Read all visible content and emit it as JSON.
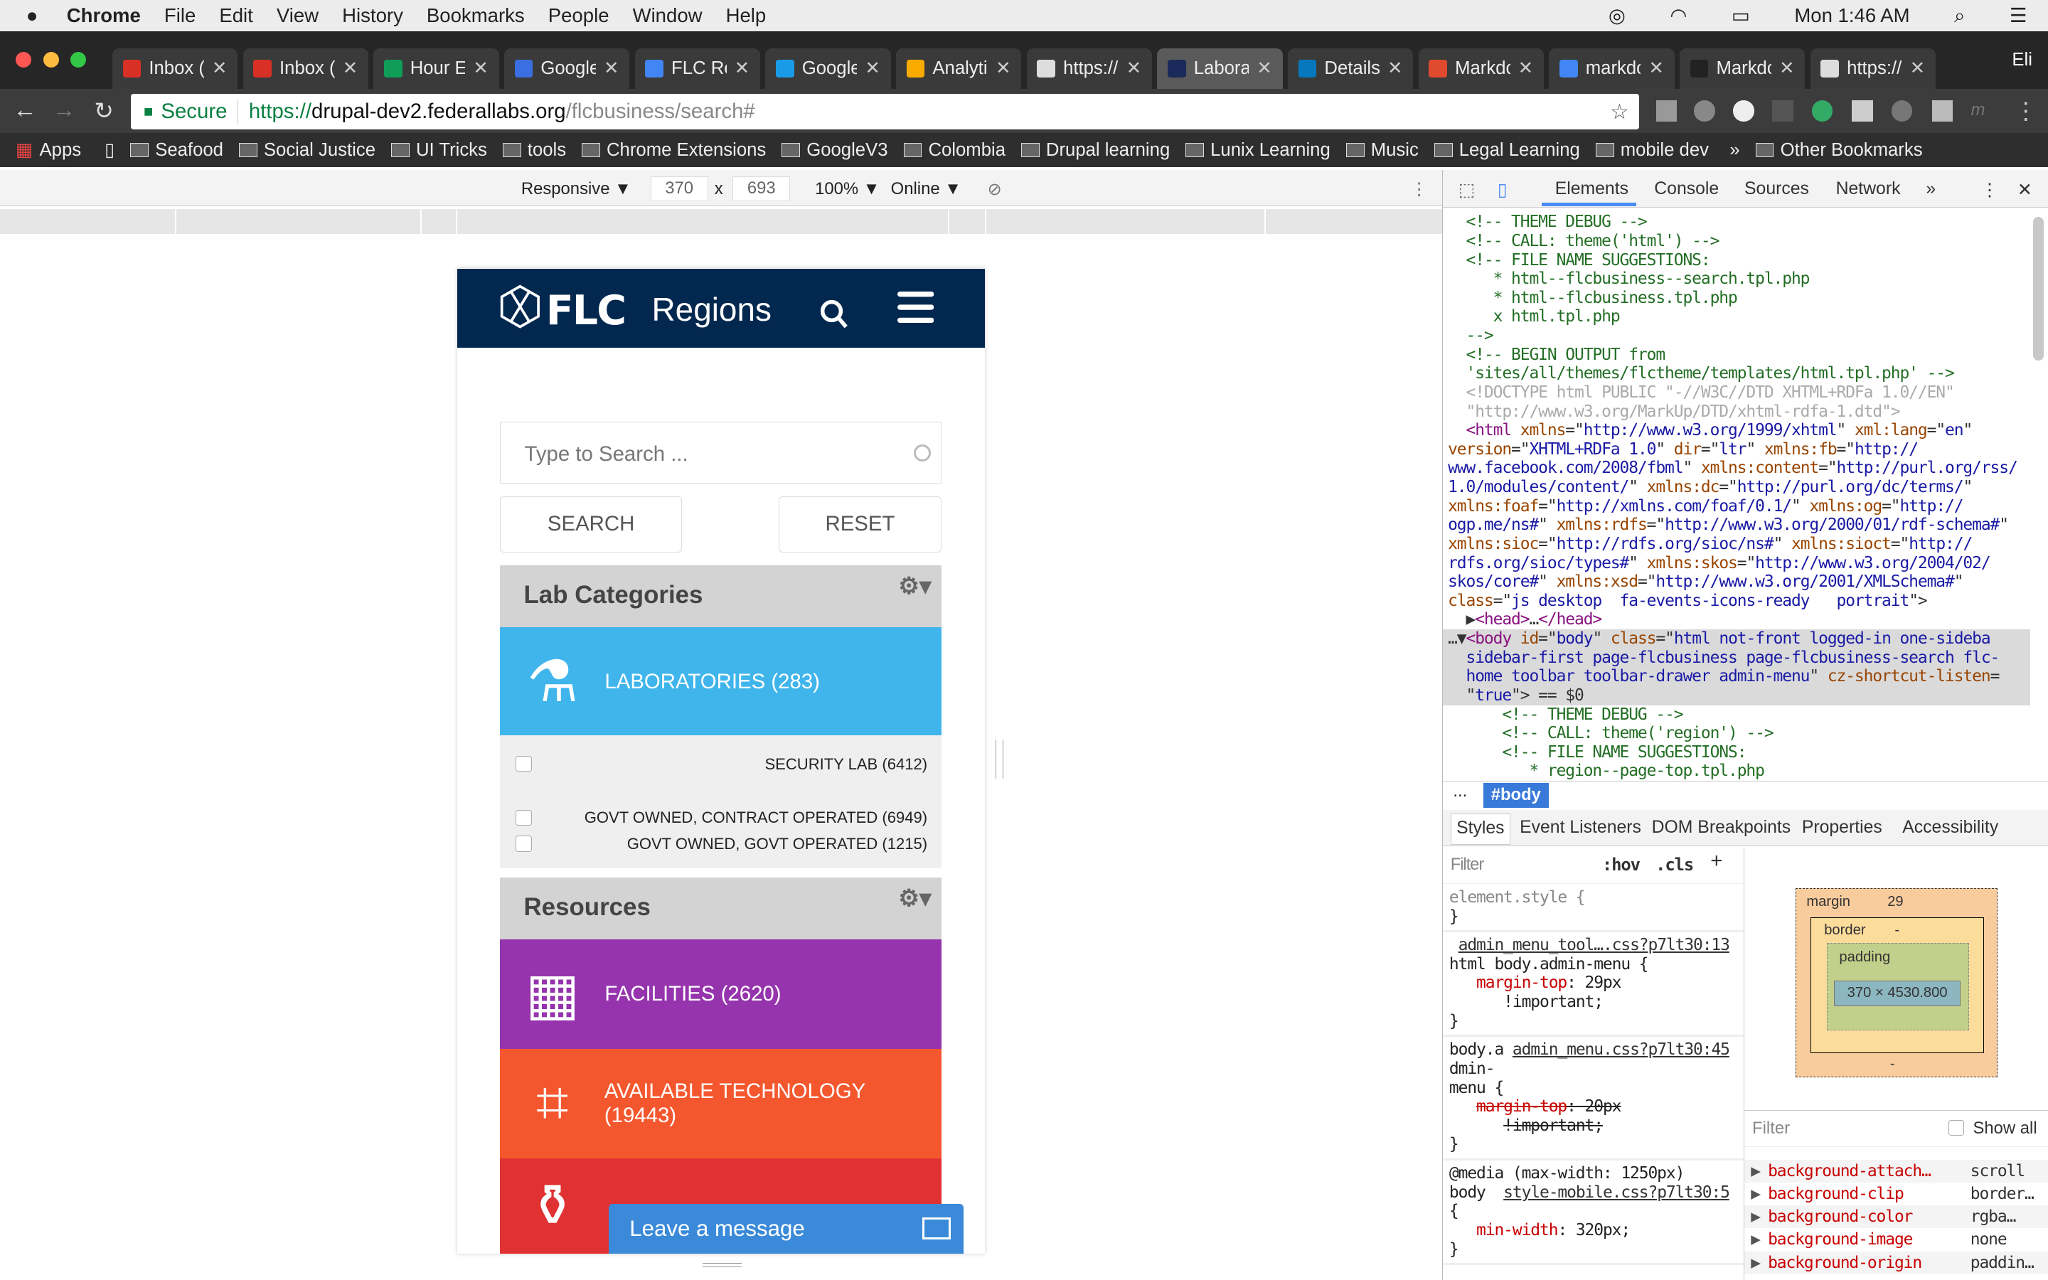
{
  "menubar": {
    "app": "Chrome",
    "items": [
      "File",
      "Edit",
      "View",
      "History",
      "Bookmarks",
      "People",
      "Window",
      "Help"
    ],
    "clock": "Mon 1:46 AM"
  },
  "tabs": [
    {
      "label": "Inbox (",
      "color": "#d93025"
    },
    {
      "label": "Inbox (",
      "color": "#d93025"
    },
    {
      "label": "Hour E",
      "color": "#0f9d58"
    },
    {
      "label": "Google",
      "color": "#3b6ee0"
    },
    {
      "label": "FLC Re",
      "color": "#4285f4"
    },
    {
      "label": "Google",
      "color": "#1a9be8"
    },
    {
      "label": "Analyti",
      "color": "#f9ab00"
    },
    {
      "label": "https://",
      "color": "#ddd"
    },
    {
      "label": "Labora",
      "color": "#1a2a5a",
      "active": true
    },
    {
      "label": "Details",
      "color": "#0678be"
    },
    {
      "label": "Markdo",
      "color": "#e04a2f"
    },
    {
      "label": "markdo",
      "color": "#4285f4"
    },
    {
      "label": "Markdo",
      "color": "#222"
    },
    {
      "label": "https://",
      "color": "#ddd"
    }
  ],
  "profile": "Eli",
  "address": {
    "secure": "Secure",
    "scheme": "https://",
    "host": "drupal-dev2.federallabs.org",
    "path": "/flcbusiness/search#"
  },
  "bookmarks": {
    "apps": "Apps",
    "items": [
      "Seafood",
      "Social Justice",
      "UI Tricks",
      "tools",
      "Chrome Extensions",
      "GoogleV3",
      "Colombia",
      "Drupal learning",
      "Lunix Learning",
      "Music",
      "Legal Learning",
      "mobile dev"
    ],
    "more": "»",
    "other": "Other Bookmarks"
  },
  "device_toolbar": {
    "mode": "Responsive ▼",
    "width": "370",
    "x": "x",
    "height": "693",
    "zoom": "100% ▼",
    "network": "Online ▼"
  },
  "page": {
    "logo": "FLC",
    "title": "Regions",
    "search_placeholder": "Type to Search ...",
    "search_btn": "SEARCH",
    "reset_btn": "RESET",
    "lab_header": "Lab Categories",
    "laboratories": "LABORATORIES (283)",
    "checks": [
      "SECURITY LAB (6412)",
      "GOVT OWNED, CONTRACT OPERATED (6949)",
      "GOVT OWNED, GOVT OPERATED (1215)"
    ],
    "resources_header": "Resources",
    "facilities": "FACILITIES (2620)",
    "technology": "AVAILABLE TECHNOLOGY (19443)",
    "leave_message": "Leave a message",
    "colors": {
      "header": "#03284f",
      "labs": "#3fb5ec",
      "facilities": "#9534ad",
      "technology": "#f4572e",
      "red": "#e03232",
      "chat": "#3b8ad9"
    }
  },
  "devtools": {
    "tabs": [
      "Elements",
      "Console",
      "Sources",
      "Network",
      "»"
    ],
    "code": [
      [
        [
          "cm",
          "  <!-- THEME DEBUG -->"
        ]
      ],
      [
        [
          "cm",
          "  <!-- CALL: theme('html') -->"
        ]
      ],
      [
        [
          "cm",
          "  <!-- FILE NAME SUGGESTIONS:"
        ]
      ],
      [
        [
          "cm",
          "     * html--flcbusiness--search.tpl.php"
        ]
      ],
      [
        [
          "cm",
          "     * html--flcbusiness.tpl.php"
        ]
      ],
      [
        [
          "cm",
          "     x html.tpl.php"
        ]
      ],
      [
        [
          "cm",
          "  -->"
        ]
      ],
      [
        [
          "cm",
          "  <!-- BEGIN OUTPUT from"
        ]
      ],
      [
        [
          "cm",
          "  'sites/all/themes/flctheme/templates/html.tpl.php' -->"
        ]
      ],
      [
        [
          "gr",
          "  <!DOCTYPE html PUBLIC \"-//W3C//DTD XHTML+RDFa 1.0//EN\""
        ]
      ],
      [
        [
          "gr",
          "  \"http://www.w3.org/MarkUp/DTD/xhtml-rdfa-1.dtd\">"
        ]
      ],
      [
        [
          "tg",
          "  <html "
        ],
        [
          "an",
          "xmlns"
        ],
        [
          "dk",
          "=\""
        ],
        [
          "av",
          "http://www.w3.org/1999/xhtml"
        ],
        [
          "dk",
          "\" "
        ],
        [
          "an",
          "xml:lang"
        ],
        [
          "dk",
          "=\""
        ],
        [
          "av",
          "en"
        ],
        [
          "dk",
          "\""
        ]
      ],
      [
        [
          "an",
          "version"
        ],
        [
          "dk",
          "=\""
        ],
        [
          "av",
          "XHTML+RDFa 1.0"
        ],
        [
          "dk",
          "\" "
        ],
        [
          "an",
          "dir"
        ],
        [
          "dk",
          "=\""
        ],
        [
          "av",
          "ltr"
        ],
        [
          "dk",
          "\" "
        ],
        [
          "an",
          "xmlns:fb"
        ],
        [
          "dk",
          "=\""
        ],
        [
          "av",
          "http://"
        ]
      ],
      [
        [
          "av",
          "www.facebook.com/2008/fbml"
        ],
        [
          "dk",
          "\" "
        ],
        [
          "an",
          "xmlns:content"
        ],
        [
          "dk",
          "=\""
        ],
        [
          "av",
          "http://purl.org/rss/"
        ]
      ],
      [
        [
          "av",
          "1.0/modules/content/"
        ],
        [
          "dk",
          "\" "
        ],
        [
          "an",
          "xmlns:dc"
        ],
        [
          "dk",
          "=\""
        ],
        [
          "av",
          "http://purl.org/dc/terms/"
        ],
        [
          "dk",
          "\""
        ]
      ],
      [
        [
          "an",
          "xmlns:foaf"
        ],
        [
          "dk",
          "=\""
        ],
        [
          "av",
          "http://xmlns.com/foaf/0.1/"
        ],
        [
          "dk",
          "\" "
        ],
        [
          "an",
          "xmlns:og"
        ],
        [
          "dk",
          "=\""
        ],
        [
          "av",
          "http://"
        ]
      ],
      [
        [
          "av",
          "ogp.me/ns#"
        ],
        [
          "dk",
          "\" "
        ],
        [
          "an",
          "xmlns:rdfs"
        ],
        [
          "dk",
          "=\""
        ],
        [
          "av",
          "http://www.w3.org/2000/01/rdf-schema#"
        ],
        [
          "dk",
          "\""
        ]
      ],
      [
        [
          "an",
          "xmlns:sioc"
        ],
        [
          "dk",
          "=\""
        ],
        [
          "av",
          "http://rdfs.org/sioc/ns#"
        ],
        [
          "dk",
          "\" "
        ],
        [
          "an",
          "xmlns:sioct"
        ],
        [
          "dk",
          "=\""
        ],
        [
          "av",
          "http://"
        ]
      ],
      [
        [
          "av",
          "rdfs.org/sioc/types#"
        ],
        [
          "dk",
          "\" "
        ],
        [
          "an",
          "xmlns:skos"
        ],
        [
          "dk",
          "=\""
        ],
        [
          "av",
          "http://www.w3.org/2004/02/"
        ]
      ],
      [
        [
          "av",
          "skos/core#"
        ],
        [
          "dk",
          "\" "
        ],
        [
          "an",
          "xmlns:xsd"
        ],
        [
          "dk",
          "=\""
        ],
        [
          "av",
          "http://www.w3.org/2001/XMLSchema#"
        ],
        [
          "dk",
          "\""
        ]
      ],
      [
        [
          "an",
          "class"
        ],
        [
          "dk",
          "=\""
        ],
        [
          "av",
          "js desktop  fa-events-icons-ready   portrait"
        ],
        [
          "dk",
          "\">"
        ]
      ],
      [
        [
          "dk",
          "  ▶"
        ],
        [
          "tg",
          "<head>"
        ],
        [
          "dk",
          "…"
        ],
        [
          "tg",
          "</head>"
        ]
      ],
      [
        [
          "dk",
          "…▼"
        ],
        [
          "tg",
          "<body "
        ],
        [
          "an",
          "id"
        ],
        [
          "dk",
          "=\""
        ],
        [
          "av",
          "body"
        ],
        [
          "dk",
          "\" "
        ],
        [
          "an",
          "class"
        ],
        [
          "dk",
          "=\""
        ],
        [
          "av",
          "html not-front logged-in one-sideba"
        ]
      ],
      [
        [
          "av",
          "  sidebar-first page-flcbusiness page-flcbusiness-search flc-"
        ]
      ],
      [
        [
          "av",
          "  home toolbar toolbar-drawer admin-menu"
        ],
        [
          "dk",
          "\" "
        ],
        [
          "an",
          "cz-shortcut-listen"
        ],
        [
          "dk",
          "="
        ]
      ],
      [
        [
          "dk",
          "  \""
        ],
        [
          "av",
          "true"
        ],
        [
          "dk",
          "\"> == $0"
        ]
      ],
      [
        [
          "cm",
          "      <!-- THEME DEBUG -->"
        ]
      ],
      [
        [
          "cm",
          "      <!-- CALL: theme('region') -->"
        ]
      ],
      [
        [
          "cm",
          "      <!-- FILE NAME SUGGESTIONS:"
        ]
      ],
      [
        [
          "cm",
          "         * region--page-top.tpl.php"
        ]
      ]
    ],
    "breadcrumb": [
      "...",
      "#body"
    ],
    "subtabs": [
      "Styles",
      "Event Listeners",
      "DOM Breakpoints",
      "Properties",
      "Accessibility"
    ],
    "styles": {
      "filter": "Filter",
      "hov": ":hov",
      "cls": ".cls",
      "plus": "+",
      "element_style": "element.style {",
      "close": "}",
      "r1_src": "admin_menu_tool….css?p7lt30:13",
      "r1_sel": "html body.admin-menu {",
      "r1_prop": "margin-top",
      "r1_val": ": 29px",
      "r1_imp": "!important;",
      "r2_sel": "body.a",
      "r2_src": "admin_menu.css?p7lt30:45",
      "r2_sel2": "dmin-",
      "r2_sel3": "menu {",
      "r2_prop": "margin-top",
      "r2_val": ": 20px",
      "r2_imp": "!important;",
      "r3_media": "@media (max-width: 1250px)",
      "r3_sel": "body",
      "r3_src": "style-mobile.css?p7lt30:5",
      "r3_open": "{",
      "r3_prop": "min-width",
      "r3_val": ": 320px;"
    },
    "boxmodel": {
      "margin_label": "margin",
      "margin_top": "29",
      "border_label": "border",
      "padding_label": "padding",
      "dash": "-",
      "content": "370 × 4530.800"
    },
    "computed": {
      "filter": "Filter",
      "show_all": "Show all",
      "rows": [
        [
          "background-attach…",
          "scroll"
        ],
        [
          "background-clip",
          "border…"
        ],
        [
          "background-color",
          "rgba…"
        ],
        [
          "background-image",
          "none"
        ],
        [
          "background-origin",
          "paddin…"
        ]
      ]
    }
  }
}
